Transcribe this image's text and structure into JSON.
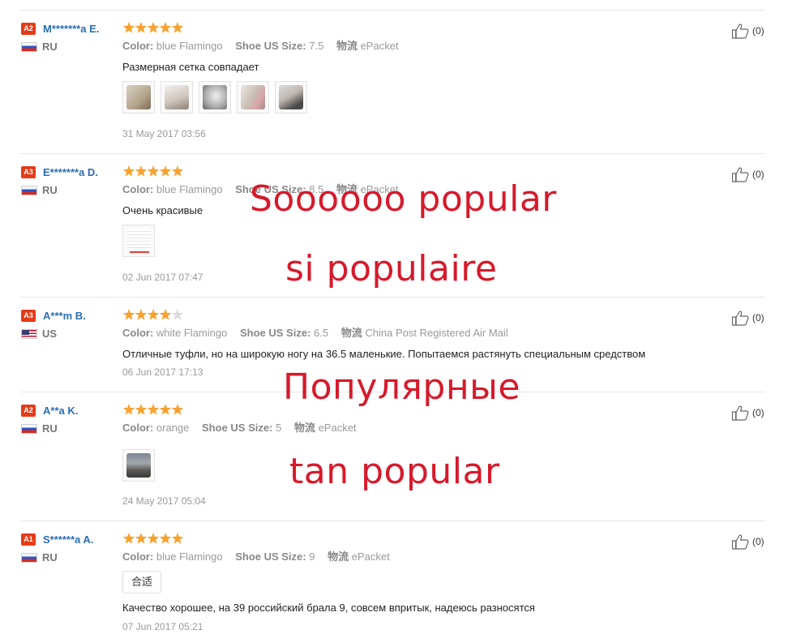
{
  "labels": {
    "color": "Color:",
    "size": "Shoe US Size:",
    "shipping": "物流"
  },
  "reviews": [
    {
      "level": "A2",
      "name": "M*******a E.",
      "country": "RU",
      "rating": 5,
      "color": "blue Flamingo",
      "size": "7.5",
      "shipping": "ePacket",
      "text": "Размерная сетка совпадает",
      "photos": 5,
      "date": "31 May 2017 03:56",
      "likes": "(0)"
    },
    {
      "level": "A3",
      "name": "E*******a D.",
      "country": "RU",
      "rating": 5,
      "color": "blue Flamingo",
      "size": "8.5",
      "shipping": "ePacket",
      "text": "Очень красивые",
      "photos": 1,
      "date": "02 Jun 2017 07:47",
      "likes": "(0)"
    },
    {
      "level": "A3",
      "name": "A***m B.",
      "country": "US",
      "rating": 4,
      "color": "white Flamingo",
      "size": "6.5",
      "shipping": "China Post Registered Air Mail",
      "text": "Отличные туфли, но на широкую ногу на 36.5 маленькие. Попытаемся растянуть специальным средством",
      "photos": 0,
      "date": "06 Jun 2017 17:13",
      "likes": "(0)"
    },
    {
      "level": "A2",
      "name": "A**a K.",
      "country": "RU",
      "rating": 5,
      "color": "orange",
      "size": "5",
      "shipping": "ePacket",
      "text": "",
      "photos": 1,
      "date": "24 May 2017 05:04",
      "likes": "(0)"
    },
    {
      "level": "A1",
      "name": "S******a A.",
      "country": "RU",
      "rating": 5,
      "color": "blue Flamingo",
      "size": "9",
      "shipping": "ePacket",
      "tag": "合适",
      "text": "Качество хорошее, на 39 российский брала 9, совсем впритык, надеюсь разносятся",
      "photos": 0,
      "date": "07 Jun 2017 05:21",
      "likes": "(0)"
    }
  ],
  "overlay": {
    "line1": "Soooooo popular",
    "line2": "si populaire",
    "line3": "Популярные",
    "line4": "tan popular"
  },
  "colors": {
    "star": "#f7a22f",
    "star_empty": "#dddddd",
    "badge": "#e43b19",
    "name": "#2a6db3",
    "overlay_text": "#d61a2b"
  }
}
